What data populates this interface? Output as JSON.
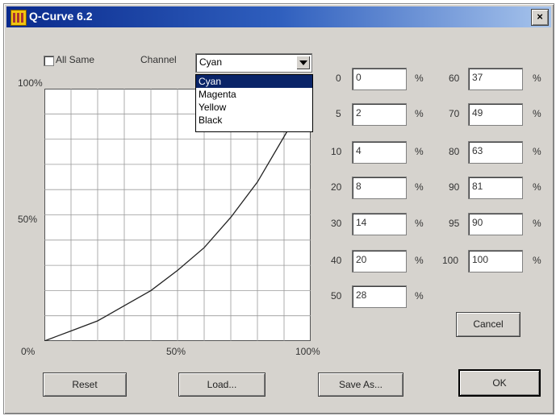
{
  "window": {
    "title": "Q-Curve 6.2",
    "close_label": "×"
  },
  "options": {
    "all_same_label": "All Same",
    "all_same_checked": false,
    "channel_label": "Channel"
  },
  "channel": {
    "selected": "Cyan",
    "options": [
      "Cyan",
      "Magenta",
      "Yellow",
      "Black"
    ]
  },
  "graph": {
    "y_top_label": "100%",
    "y_mid_label": "50%",
    "x_start_label": "0%",
    "x_mid_label": "50%",
    "x_end_label": "100%"
  },
  "curve": {
    "inputs": [
      0,
      5,
      10,
      20,
      30,
      40,
      50,
      60,
      70,
      80,
      90,
      95,
      100
    ],
    "outputs": [
      0,
      2,
      4,
      8,
      14,
      20,
      28,
      37,
      49,
      63,
      81,
      90,
      100
    ]
  },
  "percent_symbol": "%",
  "left_fields": [
    {
      "label": "0",
      "value": "0"
    },
    {
      "label": "5",
      "value": "2"
    },
    {
      "label": "10",
      "value": "4"
    },
    {
      "label": "20",
      "value": "8"
    },
    {
      "label": "30",
      "value": "14"
    },
    {
      "label": "40",
      "value": "20"
    },
    {
      "label": "50",
      "value": "28"
    }
  ],
  "right_fields": [
    {
      "label": "60",
      "value": "37"
    },
    {
      "label": "70",
      "value": "49"
    },
    {
      "label": "80",
      "value": "63"
    },
    {
      "label": "90",
      "value": "81"
    },
    {
      "label": "95",
      "value": "90"
    },
    {
      "label": "100",
      "value": "100"
    }
  ],
  "buttons": {
    "reset": "Reset",
    "load": "Load...",
    "save_as": "Save As...",
    "ok": "OK",
    "cancel": "Cancel"
  }
}
